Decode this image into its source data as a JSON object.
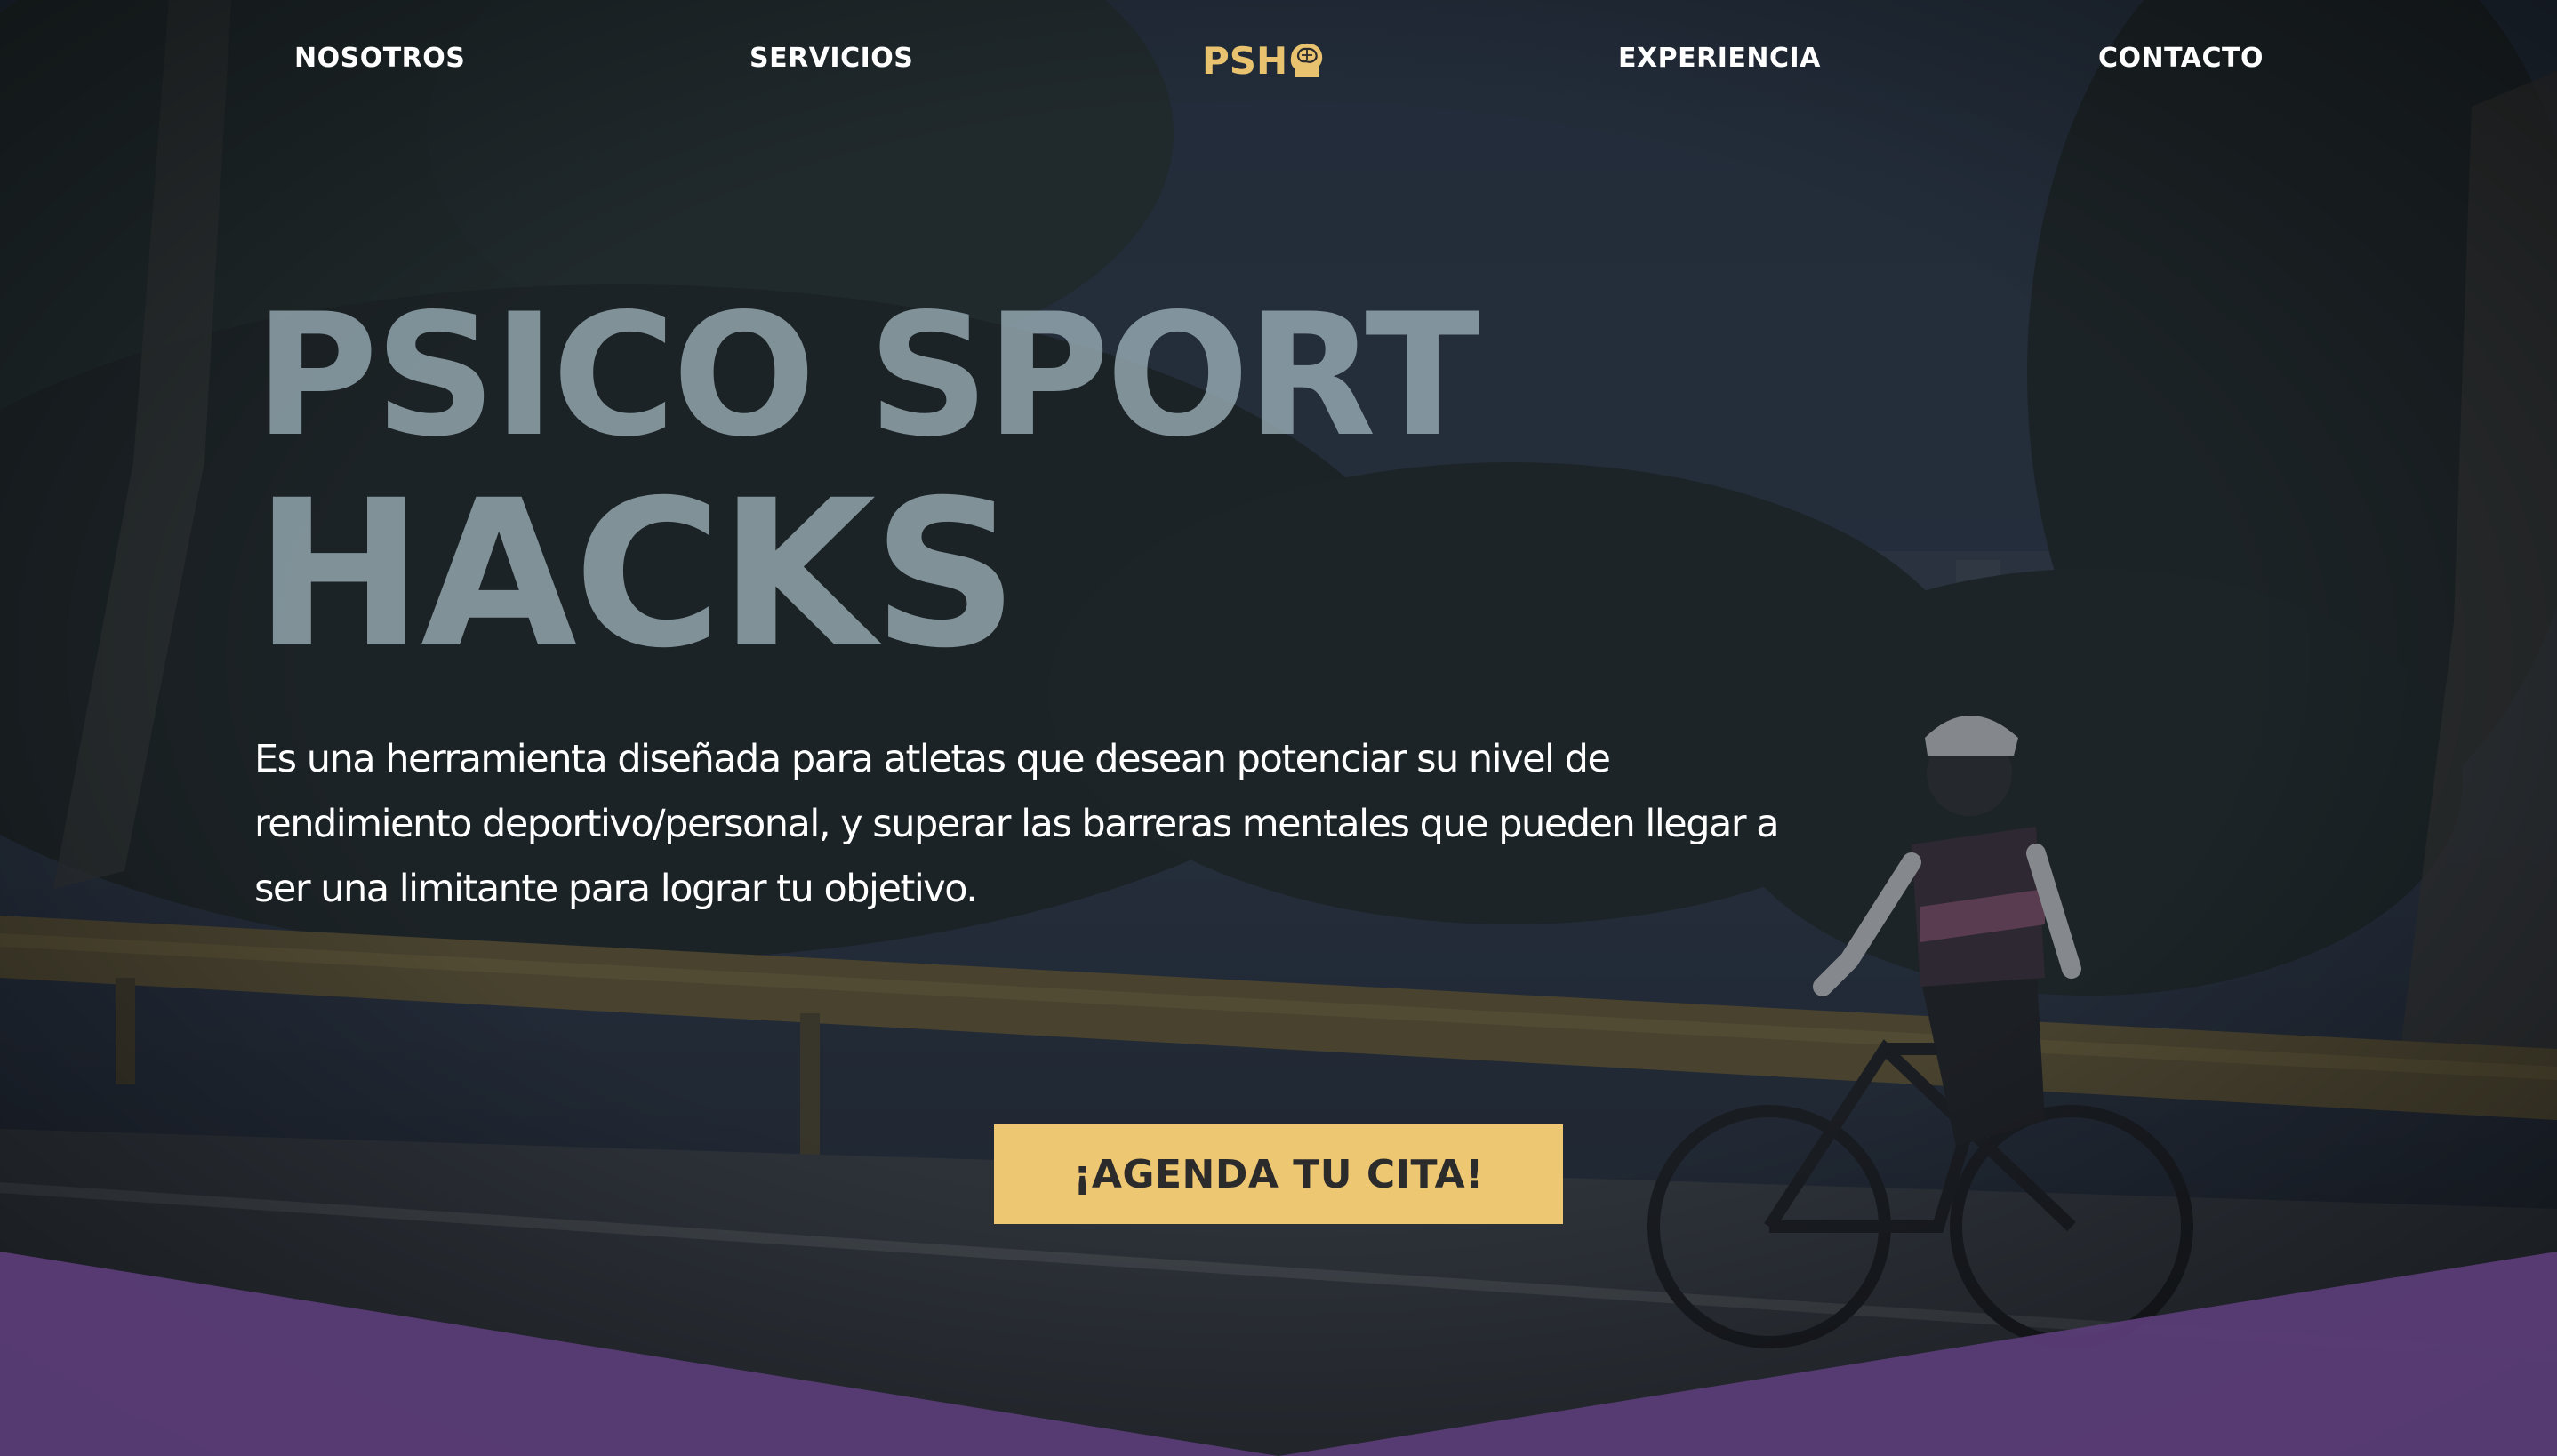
{
  "nav": {
    "items": [
      {
        "label": "NOSOTROS"
      },
      {
        "label": "SERVICIOS"
      },
      {
        "label": "EXPERIENCIA"
      },
      {
        "label": "CONTACTO"
      }
    ],
    "logo_text": "PSH",
    "logo_icon": "brain-head-icon"
  },
  "hero": {
    "title_line1": "PSICO SPORT",
    "title_line2": "HACKS",
    "subtitle": "Es una herramienta diseñada para atletas que desean potenciar su nivel de rendimiento deportivo/personal, y superar las barreras mentales que pueden llegar a ser una limitante para lograr tu objetivo.",
    "cta_label": "¡AGENDA TU CITA!"
  },
  "colors": {
    "accent_yellow": "#eec773",
    "logo_gold": "#e8c26f",
    "purple_band": "#5b3d78",
    "overlay_dark": "#1e2530"
  }
}
